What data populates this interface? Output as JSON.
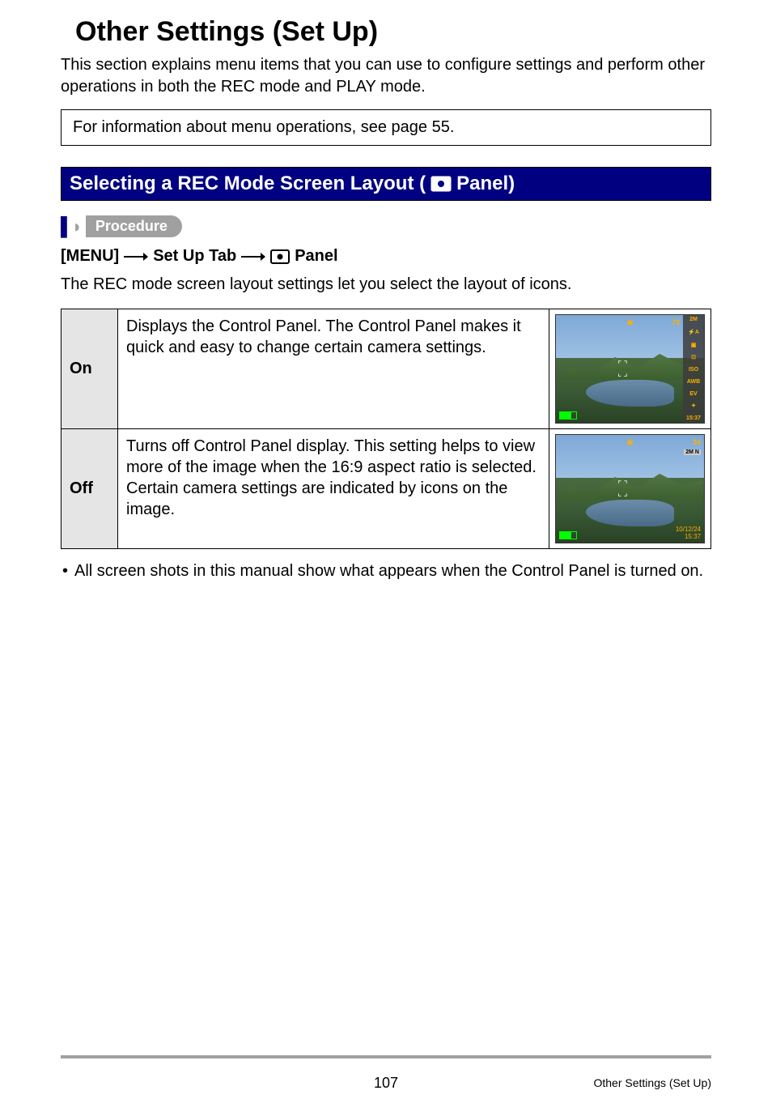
{
  "page": {
    "title": "Other Settings (Set Up)",
    "intro": "This section explains menu items that you can use to configure settings and perform other operations in both the REC mode and PLAY mode.",
    "info_box": "For information about menu operations, see page 55.",
    "section_header_prefix": "Selecting a REC Mode Screen Layout (",
    "section_header_suffix": " Panel)",
    "procedure_label": "Procedure",
    "menu_path": {
      "step1": "[MENU]",
      "step2": "Set Up Tab",
      "step3": "Panel"
    },
    "layout_desc": "The REC mode screen layout settings let you select the layout of icons.",
    "table": {
      "rows": [
        {
          "label": "On",
          "desc": "Displays the Control Panel. The Control Panel makes it quick and easy to change certain camera settings.",
          "preview": {
            "panel": true,
            "top_num": "70",
            "side_items": [
              "2M",
              "⚡A",
              "▣",
              "⊡",
              "ISO",
              "AWB",
              "EV",
              "✦",
              "15:37"
            ]
          }
        },
        {
          "label": "Off",
          "desc": "Turns off Control Panel display. This setting helps to view more of the image when the 16:9 aspect ratio is selected. Certain camera settings are indicated by icons on the image.",
          "preview": {
            "panel": false,
            "top_num": "34",
            "badge": "2M N",
            "date": "10/12/24",
            "time": "15:37"
          }
        }
      ]
    },
    "note": "All screen shots in this manual show what appears when the Control Panel is turned on."
  },
  "footer": {
    "page_number": "107",
    "section_name": "Other Settings (Set Up)"
  }
}
